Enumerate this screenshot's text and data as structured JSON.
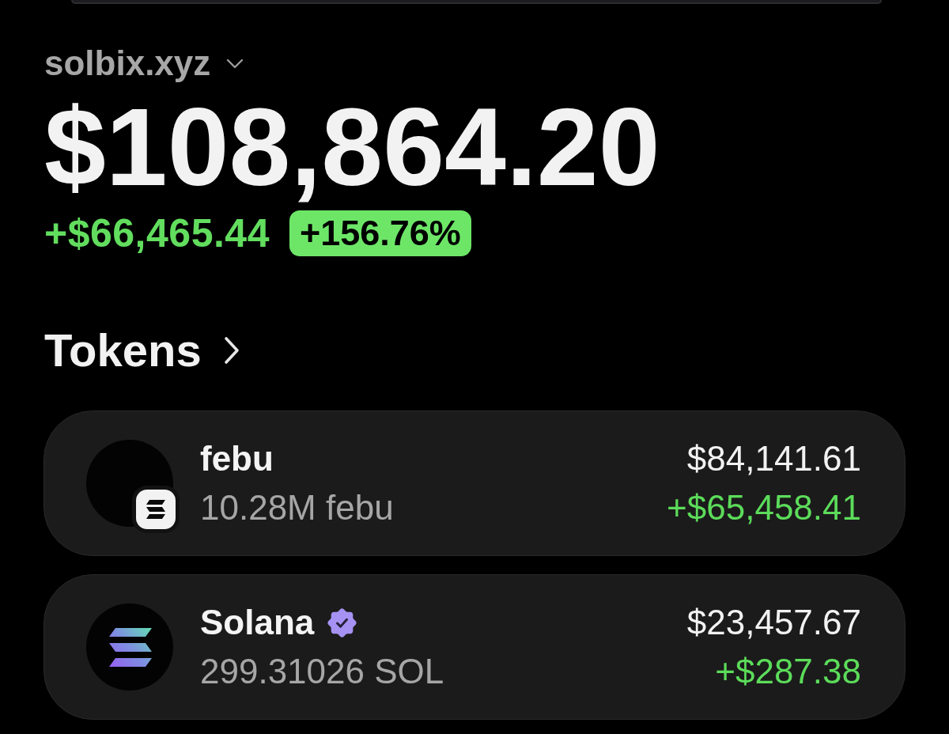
{
  "account": {
    "name": "solbix.xyz"
  },
  "balance": {
    "total": "$108,864.20",
    "change": "+$66,465.44",
    "change_percent": "+156.76%"
  },
  "tokens_section": {
    "title": "Tokens"
  },
  "tokens": [
    {
      "kind": "image",
      "name": "febu",
      "verified": false,
      "chain_badge": true,
      "amount": "10.28M febu",
      "value": "$84,141.61",
      "change": "+$65,458.41"
    },
    {
      "kind": "logo",
      "name": "Solana",
      "verified": true,
      "chain_badge": false,
      "amount": "299.31026 SOL",
      "value": "$23,457.67",
      "change": "+$287.38"
    }
  ]
}
